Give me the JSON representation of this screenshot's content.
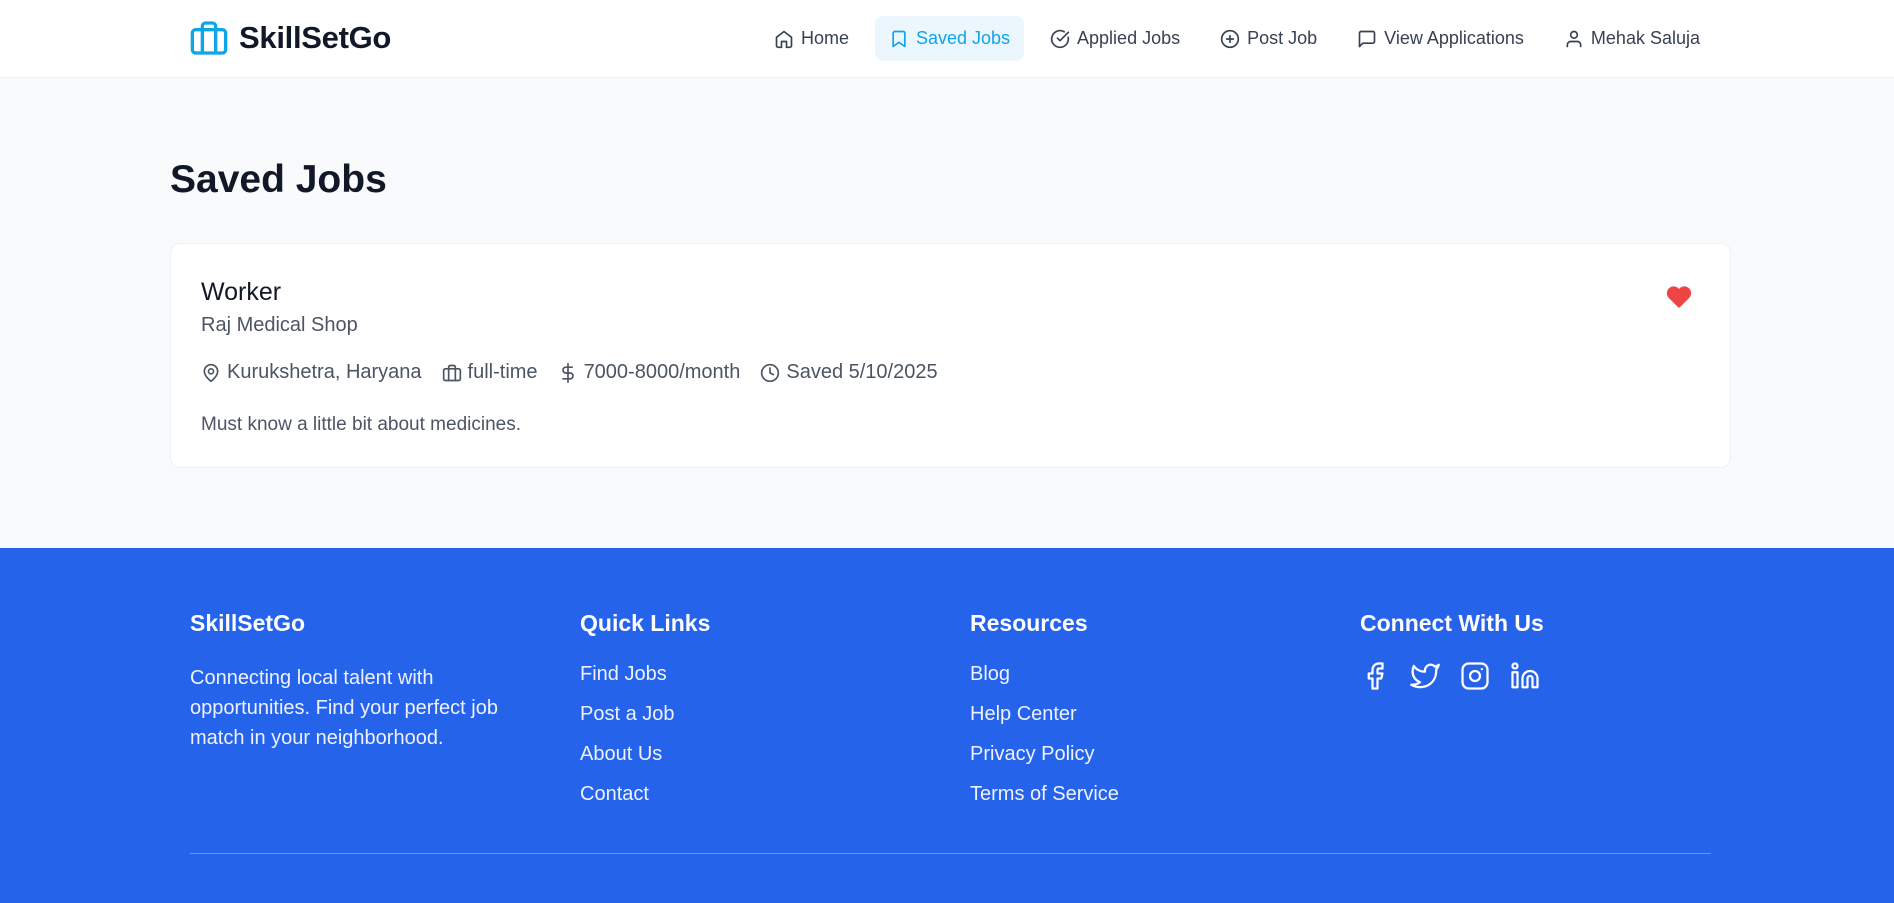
{
  "brand": {
    "name": "SkillSetGo",
    "icon": "briefcase-icon",
    "accent": "#0ea5e9"
  },
  "nav": {
    "home": "Home",
    "saved_jobs": "Saved Jobs",
    "applied_jobs": "Applied Jobs",
    "post_job": "Post Job",
    "view_applications": "View Applications",
    "user": "Mehak Saluja"
  },
  "page": {
    "title": "Saved Jobs"
  },
  "job": {
    "title": "Worker",
    "company": "Raj Medical Shop",
    "location": "Kurukshetra, Haryana",
    "type": "full-time",
    "salary": "7000-8000/month",
    "saved": "Saved 5/10/2025",
    "description": "Must know a little bit about medicines.",
    "heart_color": "#ef4444"
  },
  "footer": {
    "bg_color": "#2563eb",
    "about": {
      "heading": "SkillSetGo",
      "text": "Connecting local talent with opportunities. Find your perfect job match in your neighborhood."
    },
    "quick_links": {
      "heading": "Quick Links",
      "items": [
        "Find Jobs",
        "Post a Job",
        "About Us",
        "Contact"
      ]
    },
    "resources": {
      "heading": "Resources",
      "items": [
        "Blog",
        "Help Center",
        "Privacy Policy",
        "Terms of Service"
      ]
    },
    "connect": {
      "heading": "Connect With Us",
      "icons": [
        "facebook-icon",
        "twitter-icon",
        "instagram-icon",
        "linkedin-icon"
      ]
    }
  }
}
